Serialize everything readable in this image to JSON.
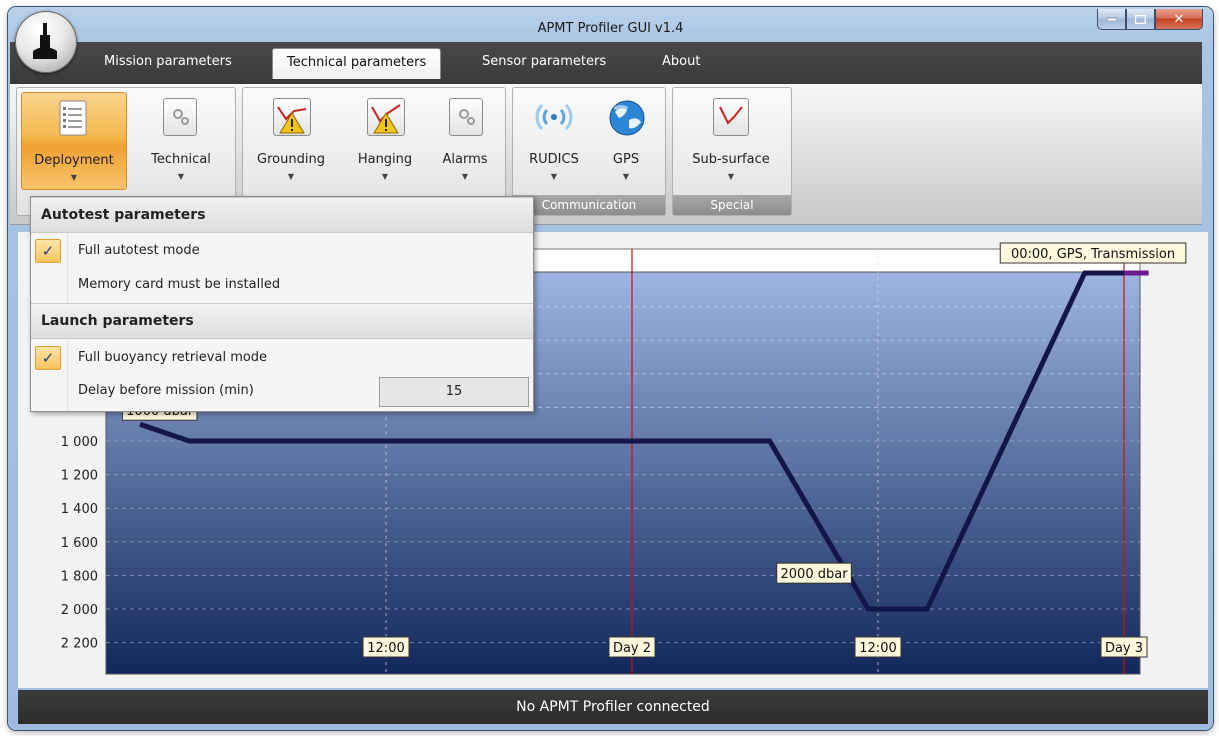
{
  "window": {
    "title": "APMT Profiler GUI v1.4"
  },
  "tabs": [
    {
      "label": "Mission parameters"
    },
    {
      "label": "Technical parameters",
      "active": true
    },
    {
      "label": "Sensor parameters"
    },
    {
      "label": "About"
    }
  ],
  "ribbon": {
    "groups": [
      {
        "label": "",
        "buttons": [
          {
            "label": "Deployment",
            "icon": "checklist-icon",
            "selected": true
          },
          {
            "label": "Technical",
            "icon": "gear-icon"
          }
        ]
      },
      {
        "label": "",
        "buttons": [
          {
            "label": "Grounding",
            "icon": "warning-graph-icon"
          },
          {
            "label": "Hanging",
            "icon": "warning-graph-icon"
          },
          {
            "label": "Alarms",
            "icon": "gear-icon"
          }
        ]
      },
      {
        "label": "Communication",
        "buttons": [
          {
            "label": "RUDICS",
            "icon": "wireless-icon"
          },
          {
            "label": "GPS",
            "icon": "globe-icon"
          }
        ]
      },
      {
        "label": "Special",
        "buttons": [
          {
            "label": "Sub-surface",
            "icon": "graph-icon"
          }
        ]
      }
    ]
  },
  "dropdown": {
    "sections": [
      {
        "header": "Autotest parameters",
        "items": [
          {
            "label": "Full autotest mode",
            "checked": true
          },
          {
            "label": "Memory card must be installed",
            "checked": false
          }
        ]
      },
      {
        "header": "Launch parameters",
        "items": [
          {
            "label": "Full buoyancy retrieval mode",
            "checked": true
          },
          {
            "label": "Delay before mission (min)",
            "value": "15"
          }
        ]
      }
    ]
  },
  "chart_data": {
    "type": "line",
    "y_tick_labels": [
      "1 000",
      "1 200",
      "1 400",
      "1 600",
      "1 800",
      "2 000",
      "2 200"
    ],
    "x_markers": [
      {
        "label": "12:00",
        "kind": "dashed"
      },
      {
        "label": "Day 2",
        "kind": "day"
      },
      {
        "label": "12:00",
        "kind": "dashed"
      },
      {
        "label": "Day 3",
        "kind": "day"
      }
    ],
    "annotations": [
      {
        "label": "1000 dbar"
      },
      {
        "label": "2000 dbar"
      },
      {
        "label": "00:00, GPS, Transmission"
      }
    ],
    "series": [
      {
        "color": "#14154a",
        "x": [
          0.0,
          0.1,
          0.82,
          1.05,
          1.28,
          1.48,
          1.6,
          1.92,
          2.0
        ],
        "y": [
          900,
          1000,
          1000,
          1000,
          1000,
          2000,
          2000,
          0,
          0
        ]
      }
    ],
    "highlight_segment": {
      "color": "#6b1a8f",
      "x": [
        2.0,
        2.05
      ],
      "y": [
        0,
        0
      ]
    },
    "ylim": [
      0,
      2300
    ],
    "colors": {
      "plot_top": "#9eb5e3",
      "plot_bottom": "#13285a",
      "day_line": "#cc1111"
    }
  },
  "status": {
    "text": "No APMT Profiler connected"
  }
}
